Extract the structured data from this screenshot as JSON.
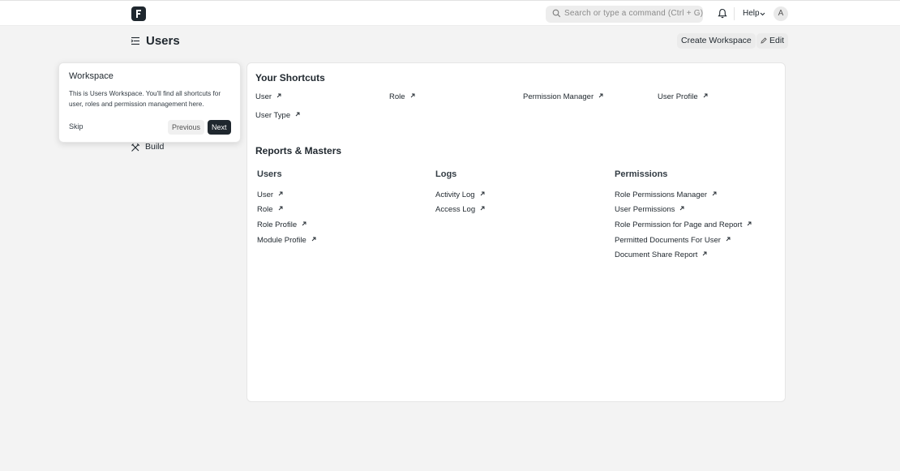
{
  "navbar": {
    "search_placeholder": "Search or type a command (Ctrl + G)",
    "help_label": "Help",
    "avatar_initial": "A"
  },
  "page": {
    "title": "Users",
    "create_workspace_label": "Create Workspace",
    "edit_label": "Edit"
  },
  "sidebar": {
    "build_label": "Build"
  },
  "tour": {
    "title": "Workspace",
    "description": "This is Users Workspace. You'll find all shortcuts for user, roles and permission management here.",
    "skip_label": "Skip",
    "previous_label": "Previous",
    "next_label": "Next"
  },
  "shortcuts": {
    "title": "Your Shortcuts",
    "items": [
      "User",
      "Role",
      "Permission Manager",
      "User Profile",
      "User Type"
    ]
  },
  "reports": {
    "title": "Reports & Masters",
    "columns": [
      {
        "heading": "Users",
        "links": [
          "User",
          "Role",
          "Role Profile",
          "Module Profile"
        ]
      },
      {
        "heading": "Logs",
        "links": [
          "Activity Log",
          "Access Log"
        ]
      },
      {
        "heading": "Permissions",
        "links": [
          "Role Permissions Manager",
          "User Permissions",
          "Role Permission for Page and Report",
          "Permitted Documents For User",
          "Document Share Report"
        ]
      }
    ]
  }
}
